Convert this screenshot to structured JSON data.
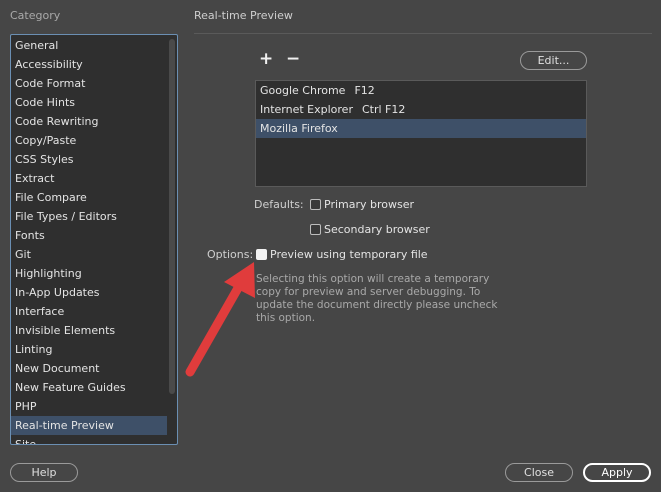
{
  "category": {
    "label": "Category",
    "items": [
      {
        "label": "General"
      },
      {
        "label": "Accessibility"
      },
      {
        "label": "Code Format"
      },
      {
        "label": "Code Hints"
      },
      {
        "label": "Code Rewriting"
      },
      {
        "label": "Copy/Paste"
      },
      {
        "label": "CSS Styles"
      },
      {
        "label": "Extract"
      },
      {
        "label": "File Compare"
      },
      {
        "label": "File Types / Editors"
      },
      {
        "label": "Fonts"
      },
      {
        "label": "Git"
      },
      {
        "label": "Highlighting"
      },
      {
        "label": "In-App Updates"
      },
      {
        "label": "Interface"
      },
      {
        "label": "Invisible Elements"
      },
      {
        "label": "Linting"
      },
      {
        "label": "New Document"
      },
      {
        "label": "New Feature Guides"
      },
      {
        "label": "PHP"
      },
      {
        "label": "Real-time Preview",
        "selected": true
      },
      {
        "label": "Site"
      }
    ]
  },
  "section": {
    "title": "Real-time Preview",
    "add_label": "+",
    "remove_label": "−",
    "edit_label": "Edit...",
    "browsers": [
      {
        "name": "Google Chrome",
        "shortcut": "F12"
      },
      {
        "name": "Internet Explorer",
        "shortcut": "Ctrl F12"
      },
      {
        "name": "Mozilla Firefox",
        "shortcut": "",
        "selected": true
      }
    ],
    "defaults_label": "Defaults:",
    "primary_label": "Primary browser",
    "primary_checked": false,
    "secondary_label": "Secondary browser",
    "secondary_checked": false,
    "options_label": "Options:",
    "temp_label": "Preview using temporary file",
    "temp_checked": true,
    "description": "Selecting this option will create a temporary copy for preview and server debugging. To update the document directly please uncheck this option."
  },
  "footer": {
    "help_label": "Help",
    "close_label": "Close",
    "apply_label": "Apply"
  },
  "colors": {
    "background": "#464646",
    "selection": "#3e5068",
    "annotation_arrow": "#e03c3c"
  }
}
